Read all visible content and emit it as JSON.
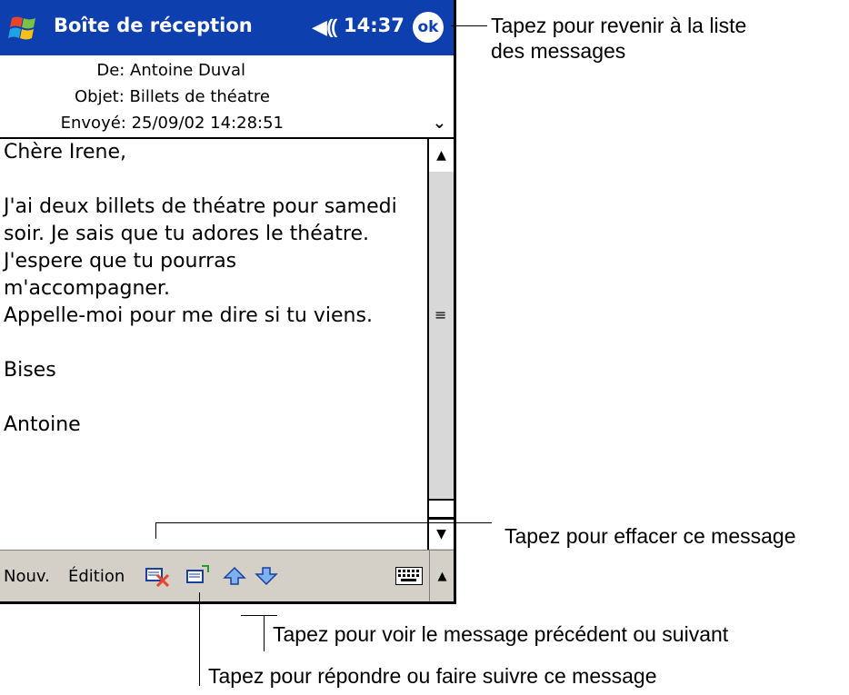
{
  "titlebar": {
    "title": "Boîte de réception",
    "time": "14:37",
    "ok_label": "ok",
    "start_icon": "windows-flag-icon",
    "sound_icon": "speaker-icon"
  },
  "message_header": {
    "from": "De: Antoine Duval",
    "subject": "Objet: Billets de théatre",
    "sent": "Envoyé: 25/09/02 14:28:51"
  },
  "message_body": [
    "Chère Irene,",
    "",
    "J'ai deux billets de théatre pour samedi",
    "soir. Je sais que tu adores le théatre.",
    "J'espere que tu pourras",
    "m'accompagner.",
    "Appelle-moi pour me dire si tu viens.",
    "",
    "Bises",
    "",
    "Antoine"
  ],
  "menubar": {
    "new_label": "Nouv.",
    "edit_label": "Édition",
    "icons": [
      "delete-message-icon",
      "reply-forward-icon",
      "previous-message-icon",
      "next-message-icon",
      "keyboard-icon"
    ]
  },
  "callouts": {
    "ok": "Tapez pour revenir à la liste\ndes messages",
    "delete": "Tapez pour effacer ce message",
    "prev_next": "Tapez pour voir le message précédent ou suivant",
    "reply": "Tapez pour répondre ou faire suivre ce message"
  },
  "colors": {
    "titlebar": "#0e3fae",
    "menubar": "#d4d0c8"
  }
}
